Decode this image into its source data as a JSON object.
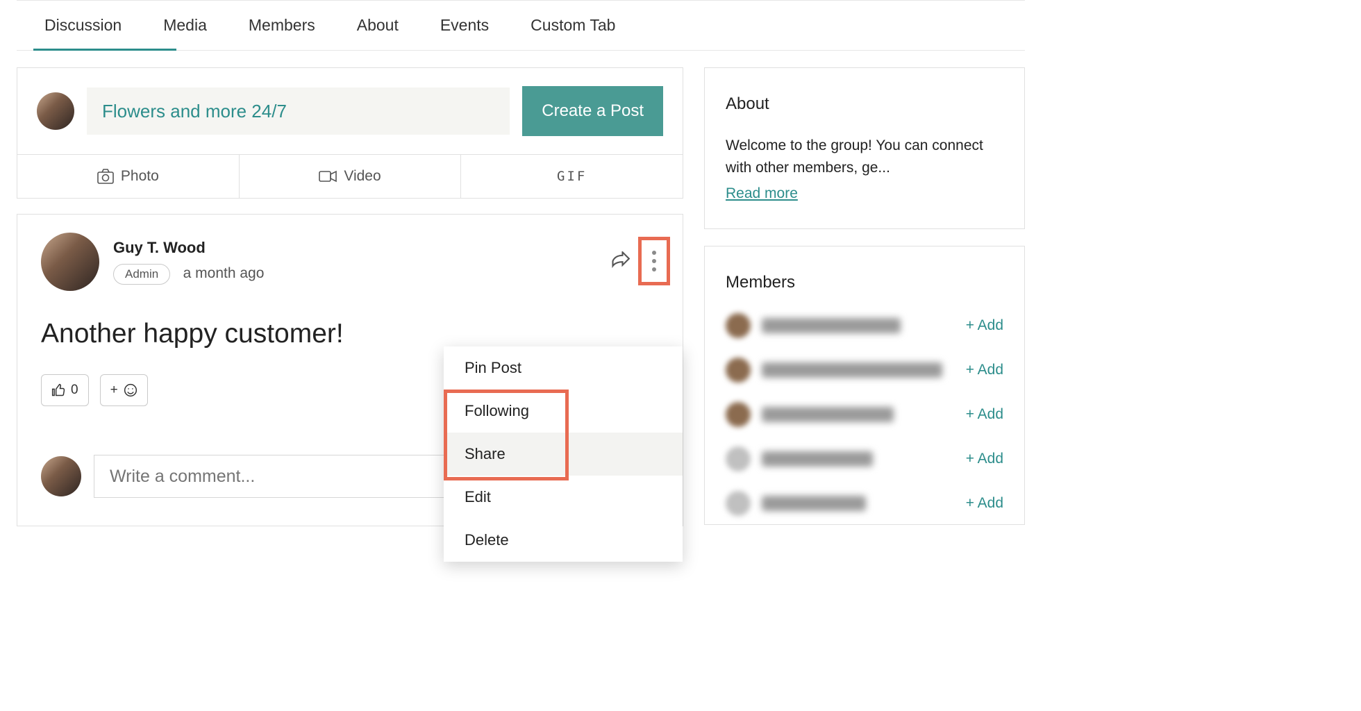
{
  "tabs": [
    "Discussion",
    "Media",
    "Members",
    "About",
    "Events",
    "Custom Tab"
  ],
  "composer": {
    "placeholder": "Flowers and more 24/7",
    "create": "Create a Post",
    "photo": "Photo",
    "video": "Video",
    "gif": "GIF"
  },
  "post": {
    "author": "Guy T. Wood",
    "badge": "Admin",
    "time": "a month ago",
    "body": "Another happy customer!",
    "like_count": "0",
    "menu": {
      "pin": "Pin Post",
      "following": "Following",
      "share": "Share",
      "edit": "Edit",
      "delete": "Delete"
    }
  },
  "comment": {
    "placeholder": "Write a comment..."
  },
  "about": {
    "title": "About",
    "text": "Welcome to the group! You can connect with other members, ge...",
    "read_more": "Read more"
  },
  "members": {
    "title": "Members",
    "add": "+ Add"
  }
}
